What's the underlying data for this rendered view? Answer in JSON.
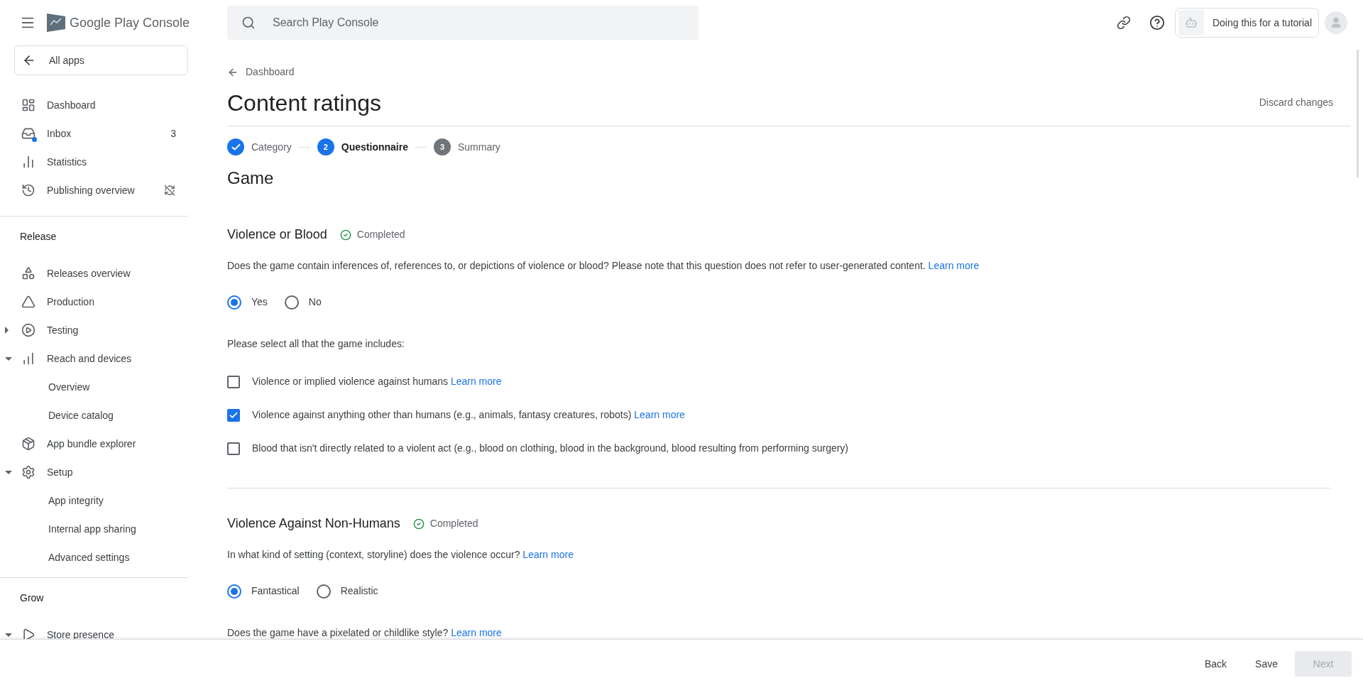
{
  "header": {
    "product": "Google Play Console",
    "search_placeholder": "Search Play Console",
    "app_chip": "Doing this for a tutorial"
  },
  "sidebar": {
    "back": "All apps",
    "groups": [
      {
        "items": [
          {
            "label": "Dashboard"
          },
          {
            "label": "Inbox",
            "badge": "3"
          },
          {
            "label": "Statistics"
          },
          {
            "label": "Publishing overview"
          }
        ]
      },
      {
        "heading": "Release",
        "items": [
          {
            "label": "Releases overview"
          },
          {
            "label": "Production"
          },
          {
            "label": "Testing",
            "expanded": false
          },
          {
            "label": "Reach and devices",
            "expanded": true,
            "children": [
              {
                "label": "Overview"
              },
              {
                "label": "Device catalog"
              }
            ]
          },
          {
            "label": "App bundle explorer"
          },
          {
            "label": "Setup",
            "expanded": true,
            "children": [
              {
                "label": "App integrity"
              },
              {
                "label": "Internal app sharing"
              },
              {
                "label": "Advanced settings"
              }
            ]
          }
        ]
      },
      {
        "heading": "Grow",
        "items": [
          {
            "label": "Store presence",
            "expanded": true
          }
        ]
      }
    ]
  },
  "breadcrumb": "Dashboard",
  "title": "Content ratings",
  "discard": "Discard changes",
  "steps": [
    {
      "label": "Category",
      "completed": true,
      "selected": false
    },
    {
      "number": "2",
      "label": "Questionnaire",
      "completed": false,
      "selected": true
    },
    {
      "number": "3",
      "label": "Summary",
      "completed": false,
      "selected": false
    }
  ],
  "category_heading": "Game",
  "sections": [
    {
      "title": "Violence or Blood",
      "status": "Completed",
      "questions": [
        {
          "kind": "radio",
          "text": "Does the game contain inferences of, references to, or depictions of violence or blood? Please note that this question does not refer to user-generated content.",
          "link": "Learn more",
          "options": [
            {
              "label": "Yes",
              "selected": true
            },
            {
              "label": "No",
              "selected": false
            }
          ]
        },
        {
          "kind": "checklist",
          "text": "Please select all that the game includes:",
          "options": [
            {
              "label": "Violence or implied violence against humans",
              "link": "Learn more",
              "checked": false
            },
            {
              "label": "Violence against anything other than humans (e.g., animals, fantasy creatures, robots)",
              "link": "Learn more",
              "checked": true
            },
            {
              "label": "Blood that isn't directly related to a violent act (e.g., blood on clothing, blood in the background, blood resulting from performing surgery)",
              "checked": false
            }
          ]
        }
      ]
    },
    {
      "title": "Violence Against Non-Humans",
      "status": "Completed",
      "questions": [
        {
          "kind": "radio",
          "text": "In what kind of setting (context, storyline) does the violence occur?",
          "link": "Learn more",
          "options": [
            {
              "label": "Fantastical",
              "selected": true
            },
            {
              "label": "Realistic",
              "selected": false
            }
          ]
        },
        {
          "kind": "text",
          "text": "Does the game have a pixelated or childlike style?",
          "link": "Learn more"
        }
      ]
    }
  ],
  "footer": [
    {
      "label": "Back",
      "disabled": false
    },
    {
      "label": "Save",
      "disabled": false
    },
    {
      "label": "Next",
      "disabled": true
    }
  ]
}
